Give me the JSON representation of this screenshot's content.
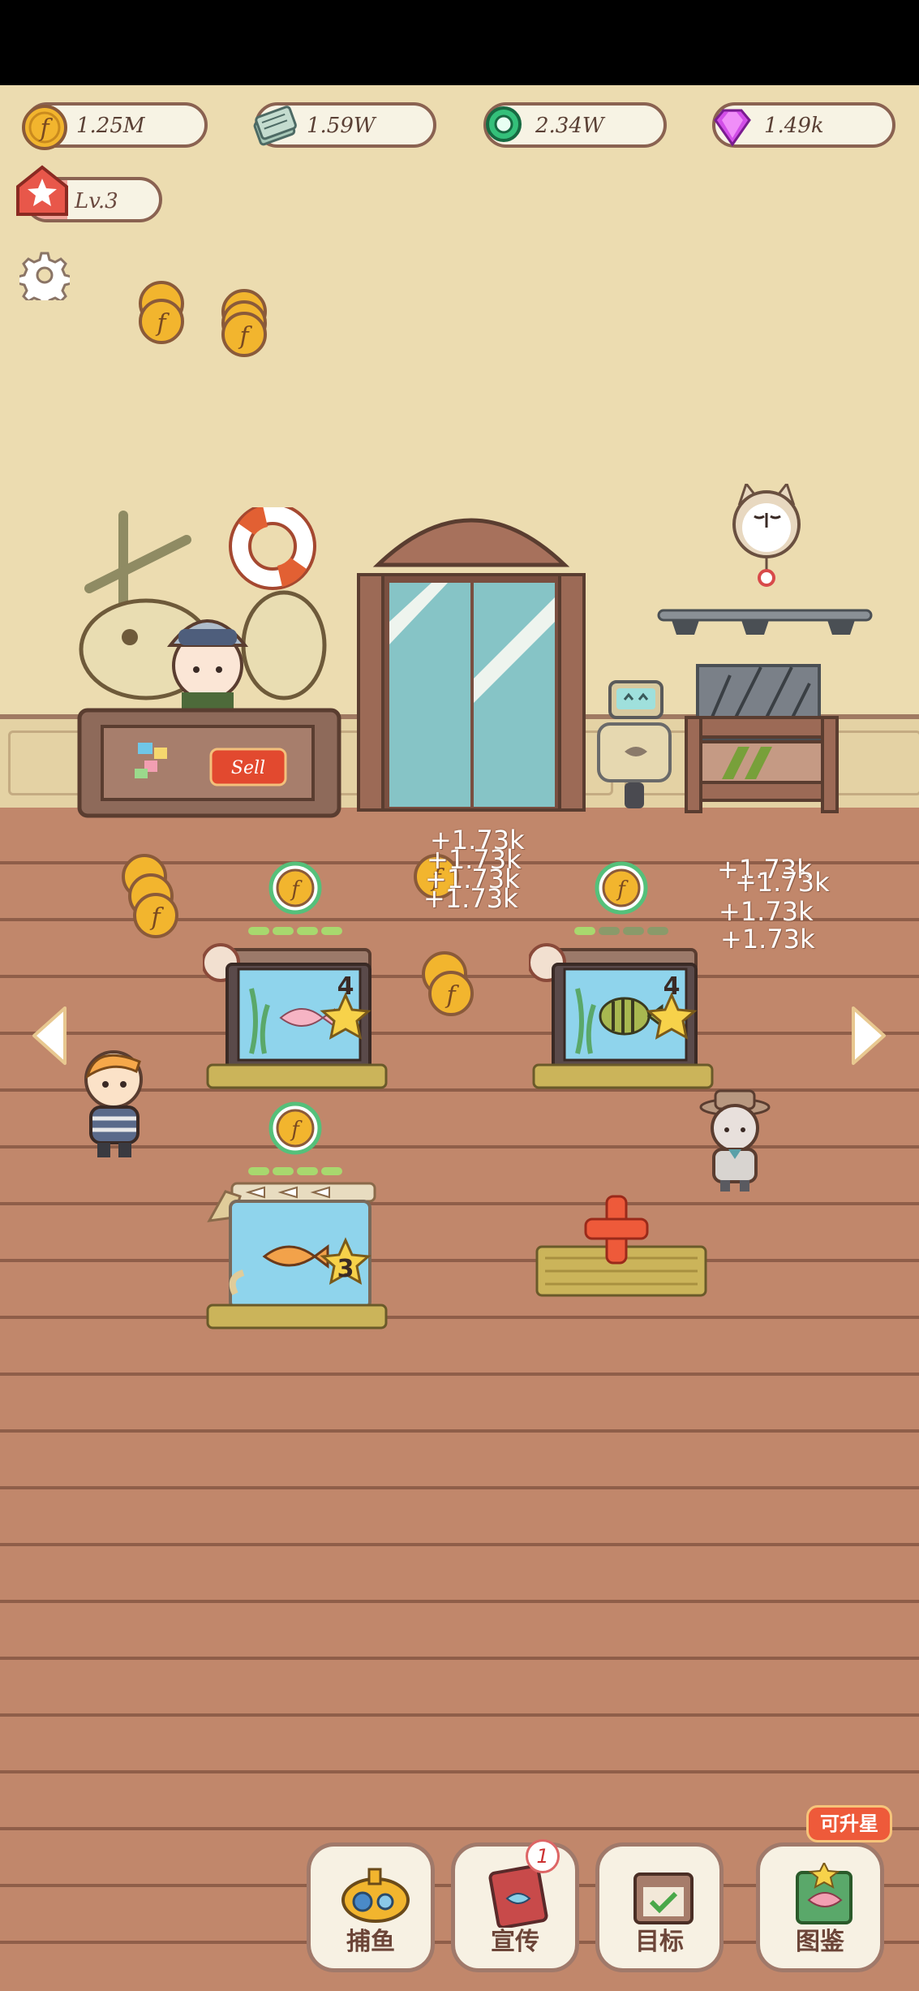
{
  "resources": {
    "coins": "1.25M",
    "cash": "1.59W",
    "pearls": "2.34W",
    "gems": "1.49k"
  },
  "player": {
    "level": "Lv.3",
    "level_progress": 0.3
  },
  "shop": {
    "sell_sign": "Sell"
  },
  "income_popups": [
    "+1.73k",
    "+1.73k",
    "+1.73k",
    "+1.73k",
    "+1.73k",
    "+1.73k",
    "+1.73k",
    "+1.73k"
  ],
  "tanks": [
    {
      "star_level": "4",
      "fish": "pink-fish"
    },
    {
      "star_level": "4",
      "fish": "striped-fish"
    },
    {
      "star_level": "3",
      "fish": "orange-fish"
    }
  ],
  "bottom_nav": {
    "fishing": "捕鱼",
    "promote": "宣传",
    "promote_badge": "1",
    "goals": "目标",
    "collection": "图鉴",
    "collection_tag": "可升星"
  },
  "colors": {
    "wall": "#ecdcb0",
    "floor": "#c1876b",
    "frame": "#8a6251",
    "accent": "#ee5a3a"
  }
}
